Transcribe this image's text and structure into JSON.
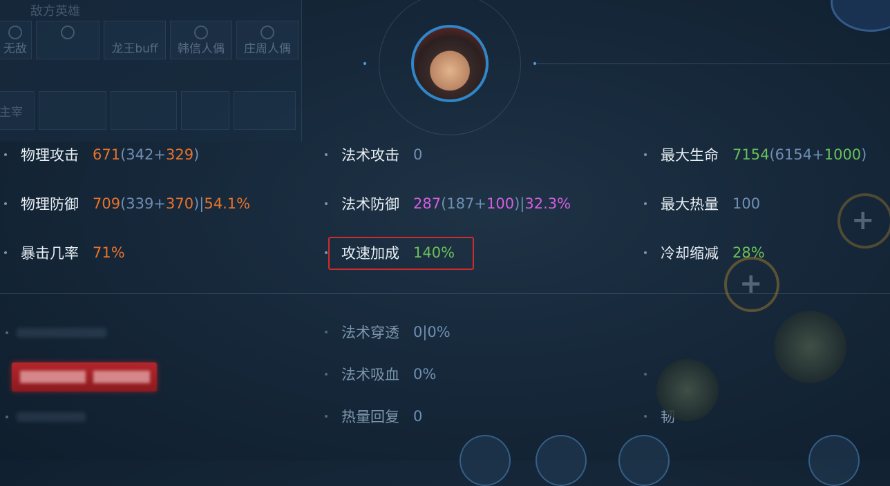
{
  "background": {
    "panel_title": "敌方英雄",
    "slots": [
      "无敌",
      "",
      "龙王buff",
      "韩信人偶",
      "庄周人偶"
    ],
    "row2_label": "主宰",
    "right_item": "韧"
  },
  "stats": {
    "phys_atk": {
      "label": "物理攻击",
      "total": "671",
      "base": "342",
      "bonus": "329"
    },
    "magic_atk": {
      "label": "法术攻击",
      "value": "0"
    },
    "max_hp": {
      "label": "最大生命",
      "total": "7154",
      "base": "6154",
      "bonus": "1000"
    },
    "phys_def": {
      "label": "物理防御",
      "total": "709",
      "base": "339",
      "bonus": "370",
      "pct": "54.1%"
    },
    "magic_def": {
      "label": "法术防御",
      "total": "287",
      "base": "187",
      "bonus": "100",
      "pct": "32.3%"
    },
    "max_heat": {
      "label": "最大热量",
      "value": "100"
    },
    "crit": {
      "label": "暴击几率",
      "value": "71%"
    },
    "atk_speed": {
      "label": "攻速加成",
      "value": "140%"
    },
    "cdr": {
      "label": "冷却缩减",
      "value": "28%"
    },
    "magic_pen": {
      "label": "法术穿透",
      "value": "0|0%"
    },
    "magic_vamp": {
      "label": "法术吸血",
      "value": "0%"
    },
    "heat_regen": {
      "label": "热量回复",
      "value": "0"
    }
  },
  "colors": {
    "orange": "#e8732a",
    "purple": "#d35fe0",
    "green": "#69c05a",
    "blue": "#6f8fb3",
    "highlight": "#d42a2a"
  }
}
